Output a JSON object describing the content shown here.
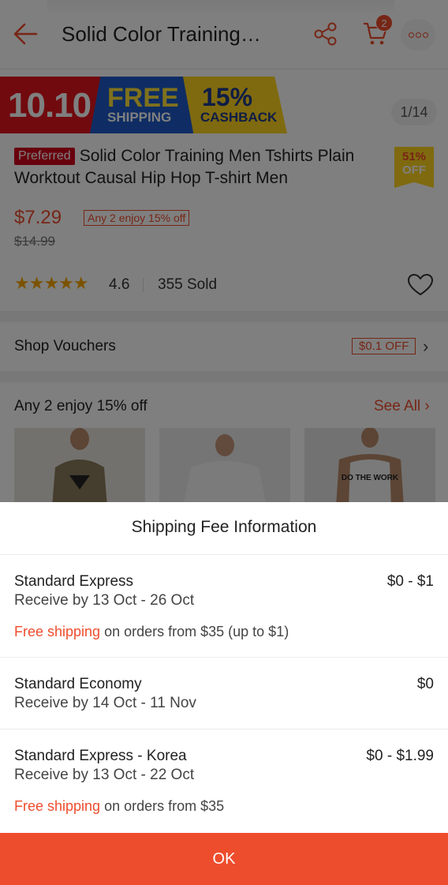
{
  "header": {
    "title": "Solid Color Training…",
    "cart_count": "2",
    "icons": [
      "back-arrow-icon",
      "share-icon",
      "cart-icon",
      "more-icon"
    ]
  },
  "banner": {
    "event": "10.10",
    "free": "FREE",
    "shipping": "SHIPPING",
    "cashback_pct": "15%",
    "cashback": "CASHBACK",
    "image_counter": "1/14"
  },
  "product": {
    "preferred_badge": "Preferred",
    "title": "Solid Color Training Men Tshirts Plain Worktout Causal Hip Hop T-shirt Men",
    "discount_pct": "51%",
    "discount_off": "OFF",
    "price": "$7.29",
    "promo_tag": "Any 2 enjoy 15% off",
    "original_price": "$14.99",
    "stars": "★★★★★",
    "rating": "4.6",
    "sold": "355 Sold"
  },
  "vouchers": {
    "label": "Shop Vouchers",
    "tag": "$0.1 OFF",
    "chevron": "›"
  },
  "bundle": {
    "label": "Any 2 enjoy 15% off",
    "see_all": "See All ›",
    "shirt_print": "DO THE WORK"
  },
  "sheet": {
    "title": "Shipping Fee Information",
    "options": [
      {
        "name": "Standard Express",
        "date": "Receive by 13 Oct - 26 Oct",
        "fee": "$0 - $1",
        "note_highlight": "Free shipping",
        "note_rest": " on orders from $35 (up to $1)"
      },
      {
        "name": "Standard Economy",
        "date": "Receive by 14 Oct - 11 Nov",
        "fee": "$0"
      },
      {
        "name": "Standard Express - Korea",
        "date": "Receive by 13 Oct - 22 Oct",
        "fee": "$0 - $1.99",
        "note_highlight": "Free shipping",
        "note_rest": " on orders from $35"
      }
    ],
    "ok_label": "OK"
  },
  "colors": {
    "accent": "#ee4d2d",
    "star": "#f6a700",
    "overlay": "rgba(0,0,0,0.5)"
  }
}
